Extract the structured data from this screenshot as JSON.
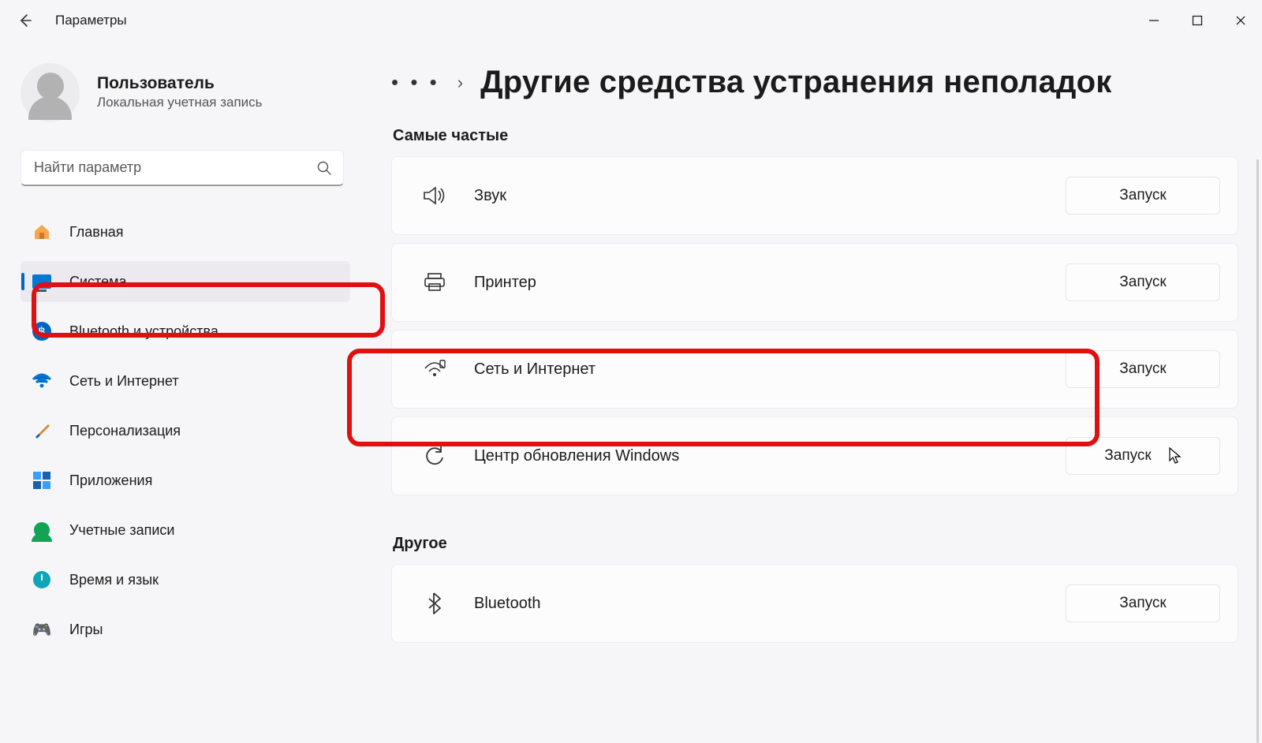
{
  "window": {
    "title": "Параметры"
  },
  "user": {
    "name": "Пользователь",
    "subtitle": "Локальная учетная запись"
  },
  "search": {
    "placeholder": "Найти параметр"
  },
  "nav": {
    "items": [
      {
        "label": "Главная"
      },
      {
        "label": "Система"
      },
      {
        "label": "Bluetooth и устройства"
      },
      {
        "label": "Сеть и Интернет"
      },
      {
        "label": "Персонализация"
      },
      {
        "label": "Приложения"
      },
      {
        "label": "Учетные записи"
      },
      {
        "label": "Время и язык"
      },
      {
        "label": "Игры"
      }
    ],
    "selected_index": 1
  },
  "breadcrumb": {
    "more": "• • •",
    "separator": "›",
    "title": "Другие средства устранения неполадок"
  },
  "sections": {
    "frequent": {
      "title": "Самые частые",
      "items": [
        {
          "icon": "sound",
          "label": "Звук",
          "action": "Запуск"
        },
        {
          "icon": "printer",
          "label": "Принтер",
          "action": "Запуск"
        },
        {
          "icon": "network",
          "label": "Сеть и Интернет",
          "action": "Запуск"
        },
        {
          "icon": "update",
          "label": "Центр обновления Windows",
          "action": "Запуск"
        }
      ]
    },
    "other": {
      "title": "Другое",
      "items": [
        {
          "icon": "bluetooth",
          "label": "Bluetooth",
          "action": "Запуск"
        }
      ]
    }
  }
}
